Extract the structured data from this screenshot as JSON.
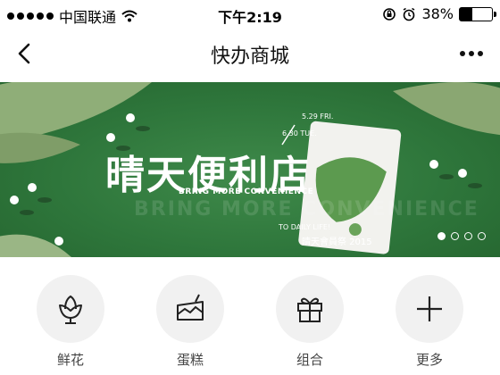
{
  "status_bar": {
    "carrier": "中国联通",
    "time": "下午2:19",
    "battery": "38%",
    "battery_level": 0.38
  },
  "nav": {
    "title": "快办商城"
  },
  "banner": {
    "title": "晴天便利店",
    "subtitle": "BRING MORE CONVENIENCE",
    "tagline": "TO DAILY LIFE!",
    "dates_start": "5.29 FRI.",
    "dates_end": "6.30 TUE.",
    "event": "晴天會員祭 2015",
    "active_slide": 1,
    "slide_count": 4
  },
  "categories": [
    {
      "label": "鲜花",
      "icon": "flower-icon"
    },
    {
      "label": "蛋糕",
      "icon": "cake-icon"
    },
    {
      "label": "组合",
      "icon": "gift-icon"
    },
    {
      "label": "更多",
      "icon": "plus-icon"
    }
  ]
}
